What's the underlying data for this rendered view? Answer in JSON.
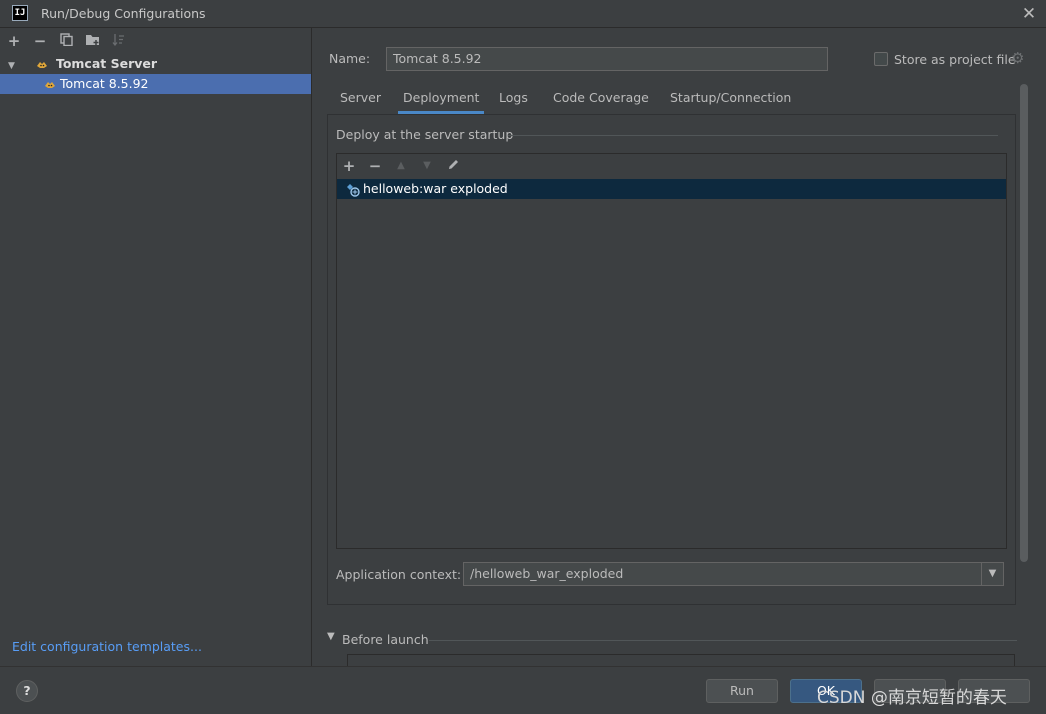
{
  "window": {
    "title": "Run/Debug Configurations",
    "logo_text": "IJ",
    "close_icon": "close-icon"
  },
  "left_toolbar": {
    "icons": [
      "add-icon",
      "remove-icon",
      "copy-icon",
      "folder-add-icon",
      "sort-icon"
    ]
  },
  "tree": {
    "group_label": "Tomcat Server",
    "child_label": "Tomcat 8.5.92"
  },
  "edit_templates_link": "Edit configuration templates...",
  "name_field": {
    "label": "Name:",
    "value": "Tomcat 8.5.92"
  },
  "store_as_project_file": {
    "label": "Store as project file",
    "checked": false
  },
  "tabs": [
    {
      "label": "Server",
      "active": false
    },
    {
      "label": "Deployment",
      "active": true
    },
    {
      "label": "Logs",
      "active": false
    },
    {
      "label": "Code Coverage",
      "active": false
    },
    {
      "label": "Startup/Connection",
      "active": false
    }
  ],
  "deployment": {
    "section_title": "Deploy at the server startup",
    "artifacts": [
      "helloweb:war exploded"
    ],
    "application_context_label": "Application context:",
    "application_context_value": "/helloweb_war_exploded"
  },
  "before_launch": {
    "label": "Before launch"
  },
  "buttons": {
    "help": "?",
    "run": "Run",
    "ok": "OK"
  },
  "watermark": "CSDN @南京短暂的春天",
  "colors": {
    "background": "#3c3f41",
    "selection": "#4b6eaf",
    "accent": "#4a88c7",
    "link": "#589df6",
    "list_selection": "#0d293e"
  }
}
